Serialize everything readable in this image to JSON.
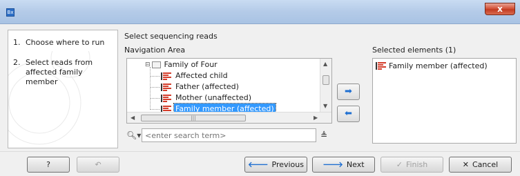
{
  "window": {
    "app_icon_label": "Bx",
    "close_label": "x"
  },
  "steps": [
    {
      "num": "1.",
      "label": "Choose where to run"
    },
    {
      "num": "2.",
      "label": "Select reads from affected family member"
    }
  ],
  "main": {
    "section_title": "Select sequencing reads",
    "navigation_label": "Navigation Area",
    "tree": {
      "folder": "Family of Four",
      "items": [
        {
          "label": "Affected child"
        },
        {
          "label": "Father (affected)"
        },
        {
          "label": "Mother (unaffected)"
        },
        {
          "label": "Family member (affected)",
          "selected": true
        }
      ]
    },
    "search": {
      "placeholder": "<enter search term>"
    }
  },
  "selected": {
    "label": "Selected elements (1)",
    "items": [
      {
        "label": "Family member (affected)"
      }
    ]
  },
  "buttons": {
    "help": "?",
    "reset": "↶",
    "previous": "Previous",
    "next": "Next",
    "finish": "Finish",
    "cancel": "Cancel"
  },
  "icons": {
    "previous": "arrow-left-icon",
    "next": "arrow-right-icon",
    "finish": "checkmark-icon",
    "cancel": "x-icon"
  }
}
